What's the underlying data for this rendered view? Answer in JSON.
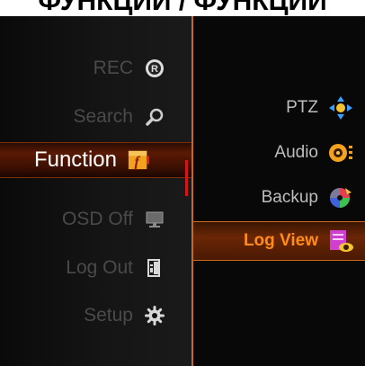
{
  "caption": "ФУНКЦИИ / ФУНКЦИИ",
  "main_menu": {
    "items": [
      {
        "label": "REC",
        "icon": "record-icon"
      },
      {
        "label": "Search",
        "icon": "search-icon"
      },
      {
        "label": "Function",
        "icon": "function-icon"
      },
      {
        "label": "OSD Off",
        "icon": "monitor-icon"
      },
      {
        "label": "Log Out",
        "icon": "logout-icon"
      },
      {
        "label": "Setup",
        "icon": "gear-icon"
      }
    ],
    "selected": "Function"
  },
  "sub_menu": {
    "items": [
      {
        "label": "PTZ",
        "icon": "ptz-arrows-icon"
      },
      {
        "label": "Audio",
        "icon": "audio-icon"
      },
      {
        "label": "Backup",
        "icon": "backup-disc-icon"
      },
      {
        "label": "Log View",
        "icon": "log-view-icon"
      }
    ],
    "selected": "Log View"
  },
  "colors": {
    "accent_orange": "#ff8c1a",
    "divider": "#c56a22",
    "active_bg": "#5a1a04"
  }
}
